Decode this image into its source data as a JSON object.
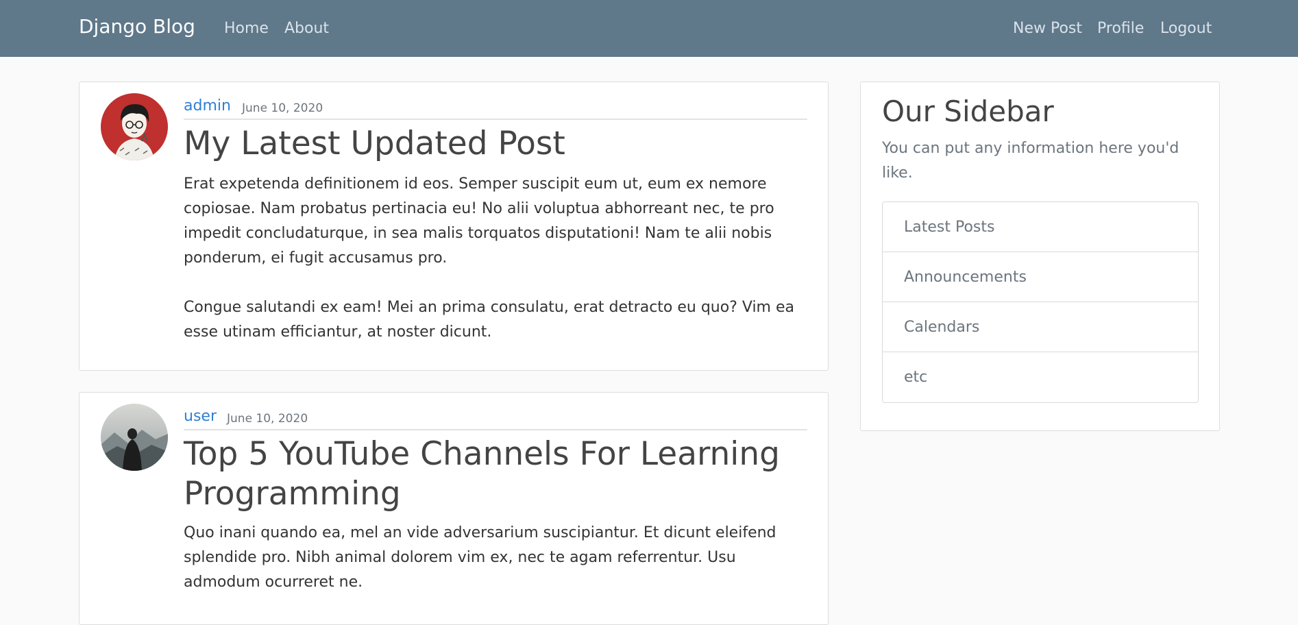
{
  "navbar": {
    "brand": "Django Blog",
    "left_links": [
      "Home",
      "About"
    ],
    "right_links": [
      "New Post",
      "Profile",
      "Logout"
    ],
    "bg_color": "#5f788a"
  },
  "posts": [
    {
      "author": "admin",
      "date": "June 10, 2020",
      "title": "My Latest Updated Post",
      "body": "Erat expetenda definitionem id eos. Semper suscipit eum ut, eum ex nemore copiosae. Nam probatus pertinacia eu! No alii voluptua abhorreant nec, te pro impedit concludaturque, in sea malis torquatos disputationi! Nam te alii nobis ponderum, ei fugit accusamus pro.\n\nCongue salutandi ex eam! Mei an prima consulatu, erat detracto eu quo? Vim ea esse utinam efficiantur, at noster dicunt.",
      "avatar_icon": "user-avatar-illustration-icon"
    },
    {
      "author": "user",
      "date": "June 10, 2020",
      "title": "Top 5 YouTube Channels For Learning Programming",
      "body": "Quo inani quando ea, mel an vide adversarium suscipiantur. Et dicunt eleifend splendide pro. Nibh animal dolorem vim ex, nec te agam referrentur. Usu admodum ocurreret ne.",
      "avatar_icon": "user-avatar-mountain-icon"
    }
  ],
  "sidebar": {
    "title": "Our Sidebar",
    "text": "You can put any information here you'd like.",
    "items": [
      "Latest Posts",
      "Announcements",
      "Calendars",
      "etc"
    ]
  }
}
